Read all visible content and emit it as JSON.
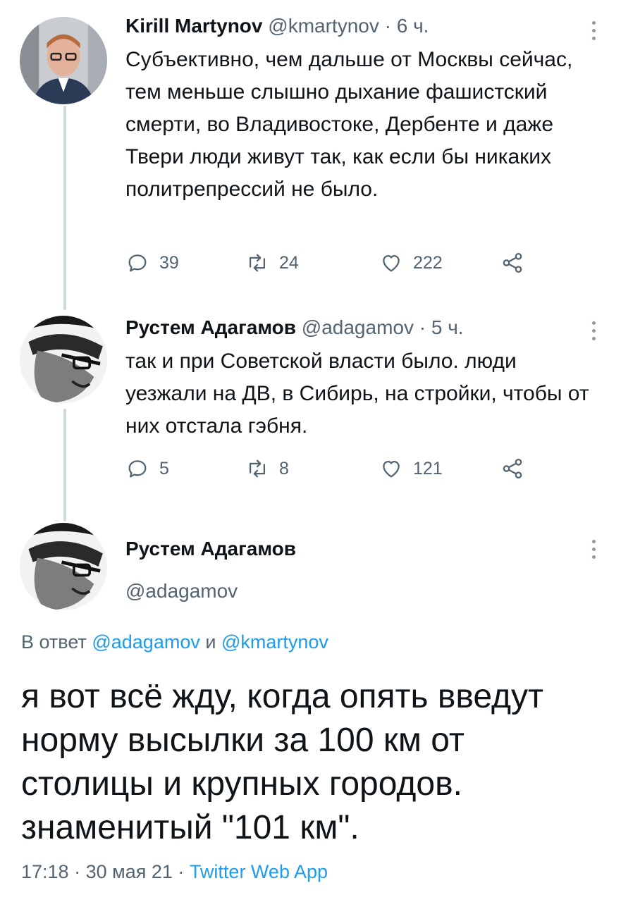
{
  "tweet1": {
    "name": "Kirill Martynov",
    "handle": "@kmartynov",
    "dot": "·",
    "time": "6 ч.",
    "text": "Субъективно, чем дальше от Москвы сейчас, тем меньше слышно дыхание фашистский смерти, во Владивостоке, Дербенте и даже Твери люди живут так, как если бы никаких политрепрессий не было.",
    "replies": "39",
    "retweets": "24",
    "likes": "222"
  },
  "tweet2": {
    "name": "Рустем Адагамов",
    "handle": "@adagamov",
    "dot": "·",
    "time": "5 ч.",
    "text": "так и при Советской власти было. люди уезжали на ДВ, в Сибирь, на стройки, чтобы от них отстала гэбня.",
    "replies": "5",
    "retweets": "8",
    "likes": "121"
  },
  "main": {
    "name": "Рустем Адагамов",
    "handle": "@adagamov",
    "reply_prefix": "В ответ",
    "reply_user1": "@adagamov",
    "reply_and": "и",
    "reply_user2": "@kmartynov",
    "text": "я вот всё жду, когда опять введут норму высылки за 100 км от столицы и крупных городов. знаменитый \"101 км\".",
    "time": "17:18",
    "dot": "·",
    "date": "30 мая 21",
    "source": "Twitter Web App"
  },
  "colors": {
    "accent": "#1d9bf0",
    "muted": "#536471",
    "thread_line": "#cfd9de"
  },
  "icons": [
    "reply-icon",
    "retweet-icon",
    "like-icon",
    "share-icon",
    "more-icon"
  ]
}
